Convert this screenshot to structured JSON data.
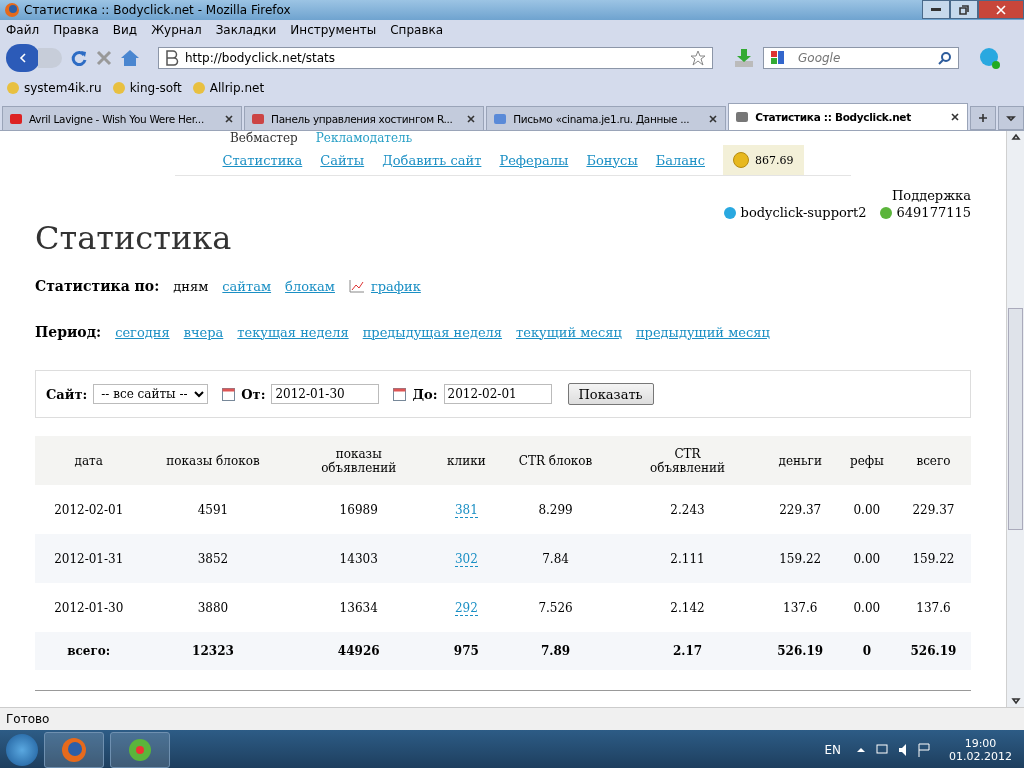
{
  "window": {
    "title": "Статистика :: Bodyclick.net - Mozilla Firefox"
  },
  "menu": [
    "Файл",
    "Правка",
    "Вид",
    "Журнал",
    "Закладки",
    "Инструменты",
    "Справка"
  ],
  "address": {
    "value": "http://bodyclick.net/stats"
  },
  "search": {
    "placeholder": "Google"
  },
  "bookmarks": [
    "system4ik.ru",
    "king-soft",
    "Allrip.net"
  ],
  "tabs": [
    {
      "label": "Avril Lavigne - Wish You Were Her...",
      "selected": false
    },
    {
      "label": "Панель управления хостингом R...",
      "selected": false
    },
    {
      "label": "Письмо «cinama.je1.ru. Данные ...",
      "selected": false
    },
    {
      "label": "Статистика :: Bodyclick.net",
      "selected": true
    }
  ],
  "page": {
    "account_tabs": [
      {
        "label": "Вебмастер",
        "selected": true
      },
      {
        "label": "Рекламодатель",
        "selected": false
      }
    ],
    "nav": [
      "Статистика",
      "Сайты",
      "Добавить сайт",
      "Рефералы",
      "Бонусы",
      "Баланс"
    ],
    "balance": "867.69",
    "support": {
      "title": "Поддержка",
      "skype": "bodyclick-support2",
      "icq": "649177115"
    },
    "heading": "Статистика",
    "group_by": {
      "label": "Статистика по:",
      "current": "дням",
      "links": [
        "сайтам",
        "блокам"
      ],
      "chart_link": "график"
    },
    "period": {
      "label": "Период:",
      "links": [
        "сегодня",
        "вчера",
        "текущая неделя",
        "предыдущая неделя",
        "текущий месяц",
        "предыдущий месяц"
      ]
    },
    "filter": {
      "site_label": "Сайт:",
      "site_value": "-- все сайты --",
      "from_label": "От:",
      "from_value": "2012-01-30",
      "to_label": "До:",
      "to_value": "2012-02-01",
      "button": "Показать"
    },
    "table": {
      "columns": [
        "дата",
        "показы блоков",
        "показы объявлений",
        "клики",
        "CTR блоков",
        "CTR объявлений",
        "деньги",
        "рефы",
        "всего"
      ],
      "rows": [
        [
          "2012-02-01",
          "4591",
          "16989",
          "381",
          "8.299",
          "2.243",
          "229.37",
          "0.00",
          "229.37"
        ],
        [
          "2012-01-31",
          "3852",
          "14303",
          "302",
          "7.84",
          "2.111",
          "159.22",
          "0.00",
          "159.22"
        ],
        [
          "2012-01-30",
          "3880",
          "13634",
          "292",
          "7.526",
          "2.142",
          "137.6",
          "0.00",
          "137.6"
        ]
      ],
      "total": [
        "всего:",
        "12323",
        "44926",
        "975",
        "7.89",
        "2.17",
        "526.19",
        "0",
        "526.19"
      ]
    }
  },
  "status_bar": "Готово",
  "taskbar": {
    "language": "EN",
    "time": "19:00",
    "date": "01.02.2012"
  }
}
